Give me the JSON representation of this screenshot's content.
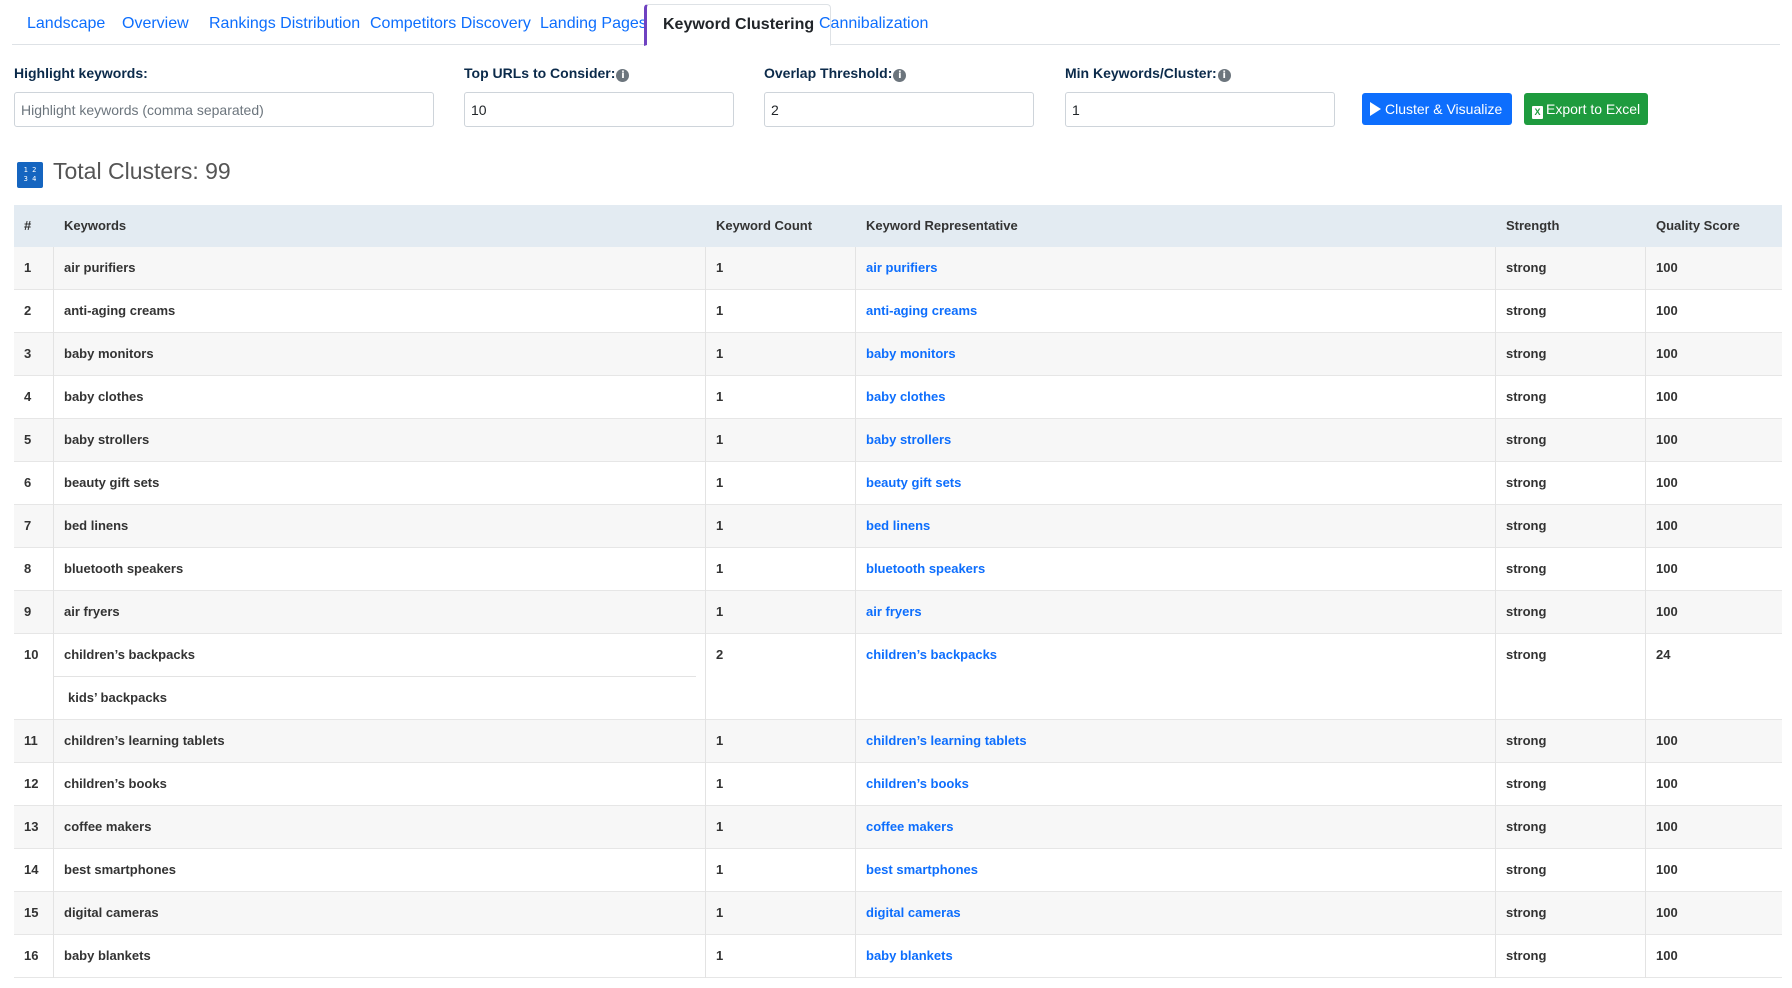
{
  "tabs": [
    {
      "label": "Landscape",
      "active": false
    },
    {
      "label": "Overview",
      "active": false
    },
    {
      "label": "Rankings Distribution",
      "active": false
    },
    {
      "label": "Competitors Discovery",
      "active": false
    },
    {
      "label": "Landing Pages",
      "active": false
    },
    {
      "label": "Keyword Clustering",
      "active": true
    },
    {
      "label": "Cannibalization",
      "active": false
    }
  ],
  "controls": {
    "highlight": {
      "label": "Highlight keywords:",
      "placeholder": "Highlight keywords (comma separated)",
      "value": ""
    },
    "top_urls": {
      "label": "Top URLs to Consider:",
      "value": "10"
    },
    "overlap": {
      "label": "Overlap Threshold:",
      "value": "2"
    },
    "min_keywords": {
      "label": "Min Keywords/Cluster:",
      "value": "1"
    },
    "cluster_button": "Cluster & Visualize",
    "export_button": "Export to Excel",
    "info_glyph": "i",
    "excel_glyph": "X"
  },
  "summary": {
    "title": "Total Clusters: 99",
    "icon": "numbers-icon",
    "icon_text_1": "1 2",
    "icon_text_2": "3 4"
  },
  "table": {
    "headers": [
      "#",
      "Keywords",
      "Keyword Count",
      "Keyword Representative",
      "Strength",
      "Quality Score"
    ],
    "rows": [
      {
        "num": "1",
        "keywords": [
          "air purifiers"
        ],
        "count": "1",
        "rep": "air purifiers",
        "strength": "strong",
        "score": "100"
      },
      {
        "num": "2",
        "keywords": [
          "anti-aging creams"
        ],
        "count": "1",
        "rep": "anti-aging creams",
        "strength": "strong",
        "score": "100"
      },
      {
        "num": "3",
        "keywords": [
          "baby monitors"
        ],
        "count": "1",
        "rep": "baby monitors",
        "strength": "strong",
        "score": "100"
      },
      {
        "num": "4",
        "keywords": [
          "baby clothes"
        ],
        "count": "1",
        "rep": "baby clothes",
        "strength": "strong",
        "score": "100"
      },
      {
        "num": "5",
        "keywords": [
          "baby strollers"
        ],
        "count": "1",
        "rep": "baby strollers",
        "strength": "strong",
        "score": "100"
      },
      {
        "num": "6",
        "keywords": [
          "beauty gift sets"
        ],
        "count": "1",
        "rep": "beauty gift sets",
        "strength": "strong",
        "score": "100"
      },
      {
        "num": "7",
        "keywords": [
          "bed linens"
        ],
        "count": "1",
        "rep": "bed linens",
        "strength": "strong",
        "score": "100"
      },
      {
        "num": "8",
        "keywords": [
          "bluetooth speakers"
        ],
        "count": "1",
        "rep": "bluetooth speakers",
        "strength": "strong",
        "score": "100"
      },
      {
        "num": "9",
        "keywords": [
          "air fryers"
        ],
        "count": "1",
        "rep": "air fryers",
        "strength": "strong",
        "score": "100"
      },
      {
        "num": "10",
        "keywords": [
          "children’s backpacks",
          "kids’ backpacks"
        ],
        "count": "2",
        "rep": "children’s backpacks",
        "strength": "strong",
        "score": "24"
      },
      {
        "num": "11",
        "keywords": [
          "children’s learning tablets"
        ],
        "count": "1",
        "rep": "children’s learning tablets",
        "strength": "strong",
        "score": "100"
      },
      {
        "num": "12",
        "keywords": [
          "children’s books"
        ],
        "count": "1",
        "rep": "children’s books",
        "strength": "strong",
        "score": "100"
      },
      {
        "num": "13",
        "keywords": [
          "coffee makers"
        ],
        "count": "1",
        "rep": "coffee makers",
        "strength": "strong",
        "score": "100"
      },
      {
        "num": "14",
        "keywords": [
          "best smartphones"
        ],
        "count": "1",
        "rep": "best smartphones",
        "strength": "strong",
        "score": "100"
      },
      {
        "num": "15",
        "keywords": [
          "digital cameras"
        ],
        "count": "1",
        "rep": "digital cameras",
        "strength": "strong",
        "score": "100"
      },
      {
        "num": "16",
        "keywords": [
          "baby blankets"
        ],
        "count": "1",
        "rep": "baby blankets",
        "strength": "strong",
        "score": "100"
      }
    ]
  }
}
